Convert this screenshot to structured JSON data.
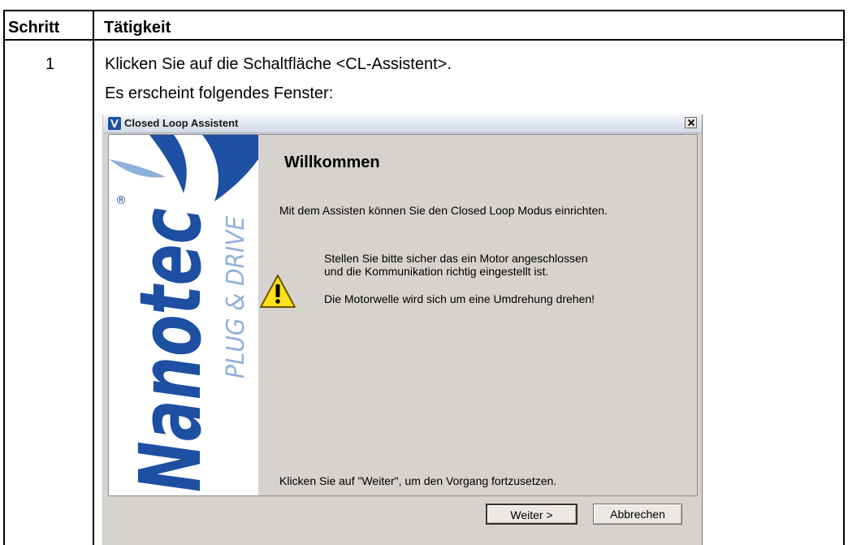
{
  "table": {
    "headers": [
      "Schritt",
      "Tätigkeit"
    ],
    "step_number": "1",
    "instruction_1": "Klicken Sie auf die Schaltfläche <CL-Assistent>.",
    "instruction_2": "Es erscheint folgendes Fenster:"
  },
  "dialog": {
    "title": "Closed Loop Assistent",
    "heading": "Willkommen",
    "intro": "Mit dem Assisten können Sie den Closed Loop Modus einrichten.",
    "note_line1": "Stellen Sie bitte sicher das ein Motor angeschlossen",
    "note_line2": "und die Kommunikation richtig eingestellt ist.",
    "warning": "Die Motorwelle wird sich um eine Umdrehung drehen!",
    "footer_hint": "Klicken Sie auf \"Weiter\", um den Vorgang fortzusetzen.",
    "next_label": "Weiter >",
    "cancel_label": "Abbrechen",
    "close_glyph": "×"
  },
  "brand": {
    "name": "Nanotec",
    "registered": "®",
    "slogan": "PLUG & DRIVE",
    "colors": {
      "primary": "#1d4fa3",
      "secondary": "#8fb0db"
    }
  },
  "icons": [
    "app-logo-icon",
    "close-icon",
    "warning-icon"
  ]
}
